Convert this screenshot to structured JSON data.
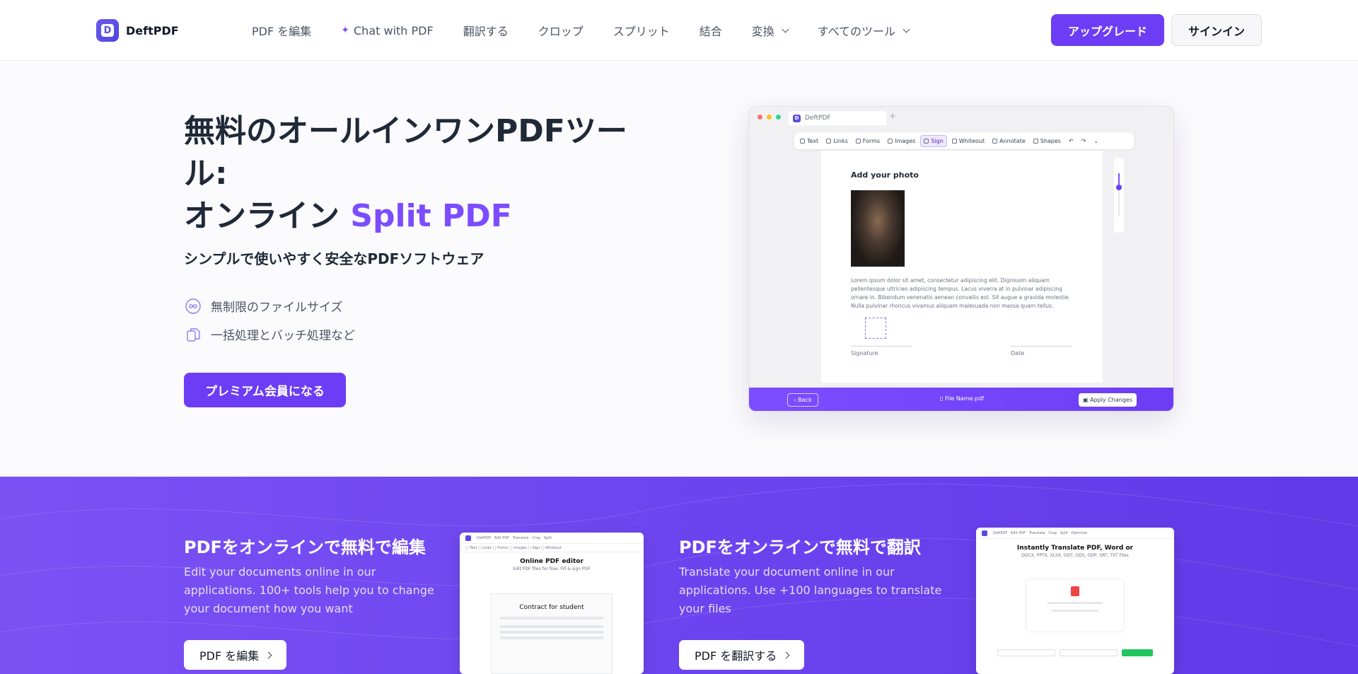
{
  "nav": {
    "logo_text": "DeftPDF",
    "items": [
      {
        "label": "PDF を編集"
      },
      {
        "label": "Chat with PDF"
      },
      {
        "label": "翻訳する"
      },
      {
        "label": "クロップ"
      },
      {
        "label": "スプリット"
      },
      {
        "label": "結合"
      },
      {
        "label": "変換"
      },
      {
        "label": "すべてのツール"
      }
    ],
    "upgrade_label": "アップグレード",
    "signin_label": "サインイン"
  },
  "hero": {
    "title_line1": "無料のオールインワンPDFツール:",
    "title_line2": "オンライン",
    "title_accent": "Split PDF",
    "subtitle": "シンプルで使いやすく安全なPDFソフトウェア",
    "features": [
      {
        "label": "無制限のファイルサイズ",
        "icon": "infinity-icon"
      },
      {
        "label": "一括処理とバッチ処理など",
        "icon": "files-icon"
      }
    ],
    "cta_label": "プレミアム会員になる"
  },
  "mockup": {
    "tab_label": "DeftPDF",
    "toolbar": [
      "Text",
      "Links",
      "Forms",
      "Images",
      "Sign",
      "Whiteout",
      "Annotate",
      "Shapes"
    ],
    "active_tool": "Sign",
    "page_title": "Add your photo",
    "page_text": "Lorem ipsum dolor sit amet, consectetur adipiscing elit. Dignissim aliquam pellentesque ultricies adipiscing tempus. Lacus viverra at in pulvinar adipiscing ornare in. Bibendum venenatis aenean convallis est. Sit augue a gravida molestie. Nulla pulvinar rhoncus vivamus aliquam malesuada non massa quam tellus.",
    "signature_label": "Signature",
    "date_label": "Date",
    "back_label": "Back",
    "file_label": "File Name.pdf",
    "apply_label": "Apply Changes"
  },
  "cards": [
    {
      "title": "PDFをオンラインで無料で編集",
      "desc": "Edit your documents online in our applications. 100+ tools help you to change your document how you want",
      "button": "PDF を編集",
      "thumb_title": "Online PDF editor",
      "thumb_sub": "Edit PDF files for free. Fill & sign PDF",
      "thumb_doc": "Contract for student"
    },
    {
      "title": "PDFをオンラインで無料で翻訳",
      "desc": "Translate your document online in our applications. Use +100 languages to translate your files",
      "button": "PDF を翻訳する",
      "thumb_title": "Instantly Translate PDF, Word or",
      "thumb_sub": "DOCX, PPTX, XLSX, ODT, ODS, ODP, SRT, TXT Files"
    }
  ],
  "colors": {
    "accent": "#6d3df5",
    "accent_text": "#7c4dff",
    "section_bg": "#6a42ee"
  }
}
